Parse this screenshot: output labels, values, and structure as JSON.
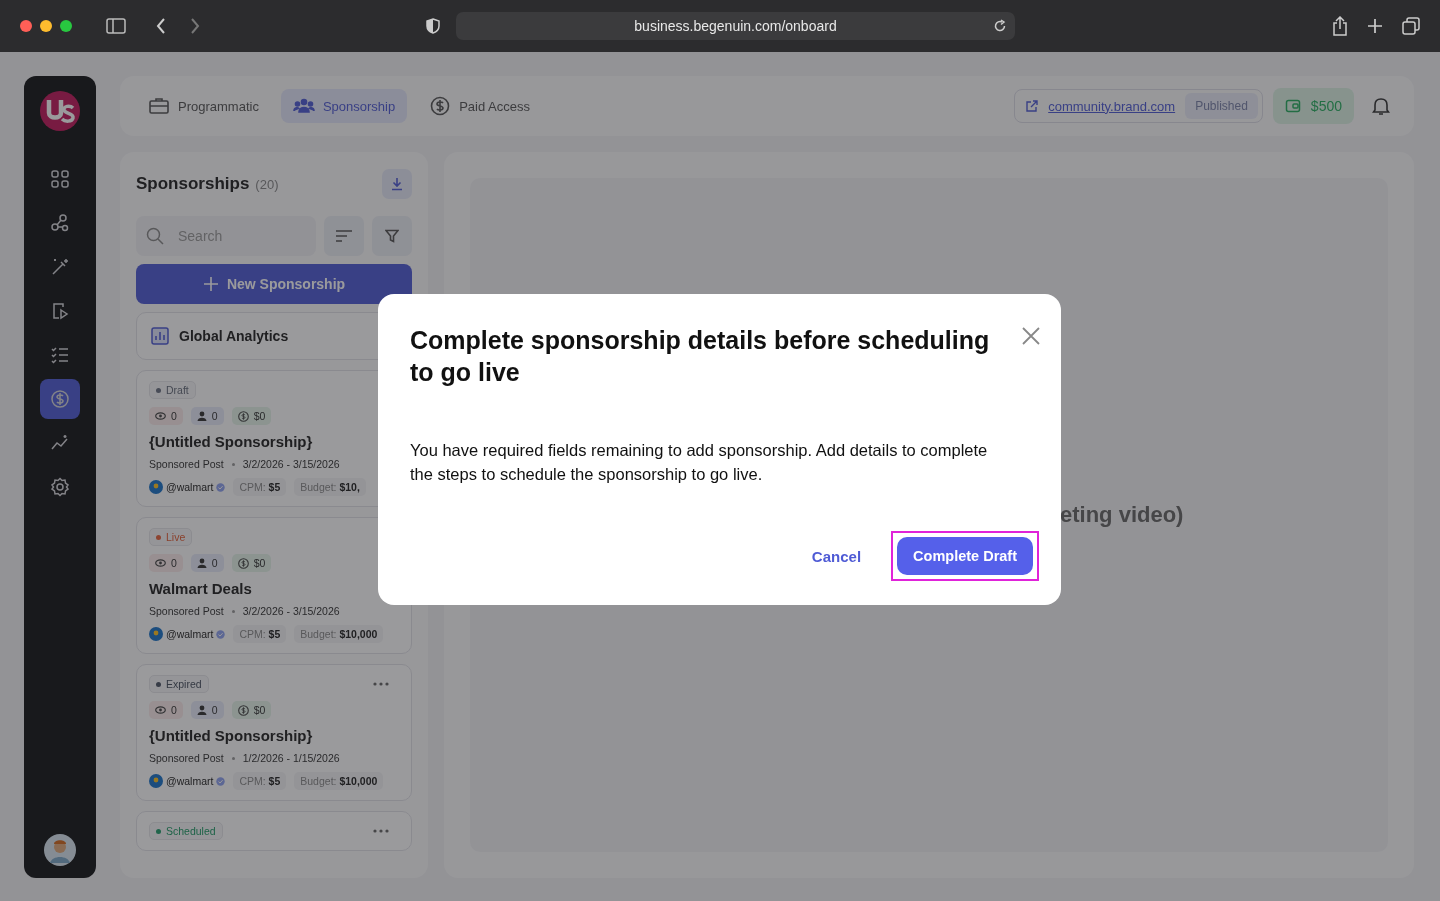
{
  "browser": {
    "url": "business.begenuin.com/onboard"
  },
  "sidebar": {
    "items": [
      {
        "selected": false
      },
      {
        "selected": false
      },
      {
        "selected": false
      },
      {
        "selected": false
      },
      {
        "selected": false
      },
      {
        "selected": true
      },
      {
        "selected": false
      },
      {
        "selected": false
      }
    ]
  },
  "tabs": [
    {
      "label": "Programmatic",
      "selected": false
    },
    {
      "label": "Sponsorship",
      "selected": true
    },
    {
      "label": "Paid Access",
      "selected": false
    }
  ],
  "header": {
    "link": "community.brand.com",
    "status": "Published",
    "balance": "$500"
  },
  "panel": {
    "title": "Sponsorships",
    "count": "(20)",
    "search": {
      "placeholder": "Search"
    },
    "new_button": "New Sponsorship",
    "analytics": "Global Analytics"
  },
  "cards": [
    {
      "status": "Draft",
      "color": "#484c57",
      "views": "0",
      "audience": "0",
      "earnings": "$0",
      "title": "{Untitled Sponsorship}",
      "type": "Sponsored Post",
      "dates": "3/2/2026 - 3/15/2026",
      "handle": "@walmart",
      "cpm_label": "CPM:",
      "cpm": "$5",
      "budget_label": "Budget:",
      "budget": "$10,",
      "menu": false
    },
    {
      "status": "Live",
      "color": "#8d4431",
      "views": "0",
      "audience": "0",
      "earnings": "$0",
      "title": "Walmart Deals",
      "type": "Sponsored Post",
      "dates": "3/2/2026 - 3/15/2026",
      "handle": "@walmart",
      "cpm_label": "CPM:",
      "cpm": "$5",
      "budget_label": "Budget:",
      "budget": "$10,000",
      "menu": false
    },
    {
      "status": "Expired",
      "color": "#373c47",
      "views": "0",
      "audience": "0",
      "earnings": "$0",
      "title": "{Untitled Sponsorship}",
      "type": "Sponsored Post",
      "dates": "1/2/2026 - 1/15/2026",
      "handle": "@walmart",
      "cpm_label": "CPM:",
      "cpm": "$5",
      "budget_label": "Budget:",
      "budget": "$10,000",
      "menu": true
    },
    {
      "status": "Scheduled",
      "color": "#20654b",
      "menu": true
    }
  ],
  "main": {
    "background_text": "eting video)"
  },
  "modal": {
    "title": "Complete sponsorship details before scheduling to go live",
    "message": "You have required fields remaining to add sponsorship. Add details to complete the steps to schedule the sponsorship to go live.",
    "cancel": "Cancel",
    "confirm": "Complete Draft",
    "highlighted": true
  }
}
